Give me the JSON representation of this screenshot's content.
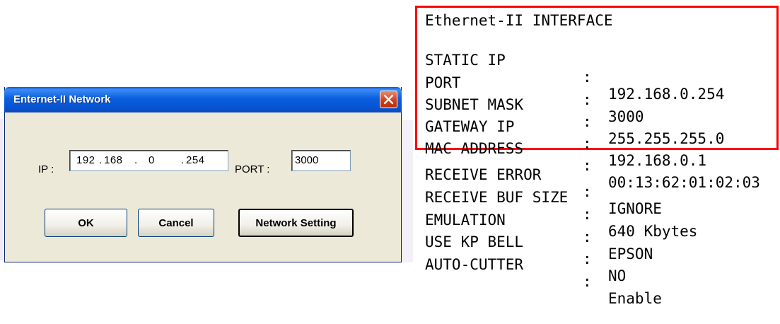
{
  "dialog": {
    "title": "Enternet-II Network",
    "ip_label": "IP :",
    "ip_octets": [
      "192",
      "168",
      "0",
      "254"
    ],
    "ip_separators": [
      ".",
      ".",
      "."
    ],
    "port_label": "PORT :",
    "port_value": "3000",
    "buttons": {
      "ok": "OK",
      "cancel": "Cancel",
      "network_setting": "Network Setting"
    },
    "icons": {
      "close": "close-icon"
    }
  },
  "printout": {
    "header": "Ethernet-II INTERFACE",
    "rows": [
      {
        "key": "STATIC IP",
        "sep": ":",
        "value": "192.168.0.254"
      },
      {
        "key": "PORT",
        "sep": ":",
        "value": "3000"
      },
      {
        "key": "SUBNET MASK",
        "sep": ":",
        "value": "255.255.255.0"
      },
      {
        "key": "GATEWAY IP",
        "sep": ":",
        "value": "192.168.0.1"
      },
      {
        "key": "MAC ADDRESS",
        "sep": ":",
        "value": "00:13:62:01:02:03"
      },
      {
        "key": "RECEIVE ERROR",
        "sep": ":",
        "value": "IGNORE"
      },
      {
        "key": "RECEIVE BUF SIZE",
        "sep": ":",
        "value": "640 Kbytes"
      },
      {
        "key": "EMULATION",
        "sep": ":",
        "value": "EPSON"
      },
      {
        "key": "USE KP BELL",
        "sep": ":",
        "value": "NO"
      },
      {
        "key": "AUTO-CUTTER",
        "sep": ":",
        "value": "Enable"
      }
    ]
  },
  "colors": {
    "highlight_border": "#ff0000",
    "titlebar": "#0a5fdd",
    "dialog_bg": "#ece9d8"
  }
}
